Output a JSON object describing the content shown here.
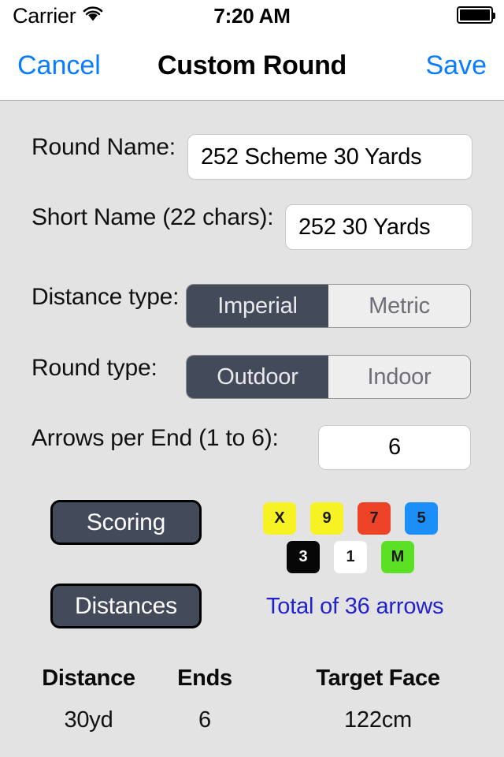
{
  "status_bar": {
    "carrier": "Carrier",
    "wifi_icon": "wifi-icon",
    "time": "7:20 AM",
    "battery_icon": "battery-full-icon"
  },
  "nav_bar": {
    "cancel_label": "Cancel",
    "title": "Custom Round",
    "save_label": "Save",
    "tint_color": "#0a7cff"
  },
  "form": {
    "round_name": {
      "label": "Round Name:",
      "value": "252 Scheme 30 Yards",
      "placeholder": "Round Name"
    },
    "short_name": {
      "label": "Short Name (22 chars):",
      "value": "252 30 Yards",
      "placeholder": "Short Name"
    },
    "distance_type": {
      "label": "Distance type:",
      "options": [
        "Imperial",
        "Metric"
      ],
      "selected": "Imperial"
    },
    "round_type": {
      "label": "Round type:",
      "options": [
        "Outdoor",
        "Indoor"
      ],
      "selected": "Outdoor"
    },
    "arrows_per_end": {
      "label": "Arrows per End (1 to 6):",
      "value": "6",
      "placeholder": "6"
    }
  },
  "actions": {
    "scoring_label": "Scoring",
    "distances_label": "Distances",
    "button_color": "#434b5b"
  },
  "scoring_zones": [
    {
      "label": "X",
      "bg": "#f7f224",
      "fg": "#1a1a1a"
    },
    {
      "label": "9",
      "bg": "#f7f224",
      "fg": "#1a1a1a"
    },
    {
      "label": "7",
      "bg": "#ec4326",
      "fg": "#1a1a1a"
    },
    {
      "label": "5",
      "bg": "#1b8ef7",
      "fg": "#1a1a1a"
    },
    {
      "label": "3",
      "bg": "#070707",
      "fg": "#ffffff"
    },
    {
      "label": "1",
      "bg": "#ffffff",
      "fg": "#1a1a1a"
    },
    {
      "label": "M",
      "bg": "#5ce026",
      "fg": "#1a1a1a"
    }
  ],
  "total_arrows": {
    "text": "Total of 36 arrows",
    "color": "#2222cc"
  },
  "distance_table": {
    "columns": [
      "Distance",
      "Ends",
      "Target Face"
    ],
    "rows": [
      {
        "distance": "30yd",
        "ends": "6",
        "target_face": "122cm"
      }
    ]
  }
}
